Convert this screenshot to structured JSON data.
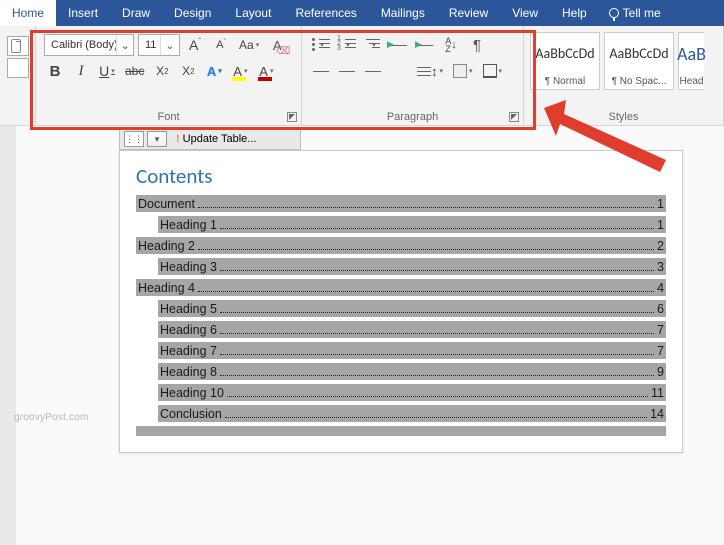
{
  "tabs": {
    "items": [
      "Home",
      "Insert",
      "Draw",
      "Design",
      "Layout",
      "References",
      "Mailings",
      "Review",
      "View",
      "Help"
    ],
    "active": "Home",
    "tell_me": "Tell me"
  },
  "font": {
    "name": "Calibri (Body)",
    "size": "11",
    "label": "Font",
    "bold": "B",
    "italic": "I",
    "underline": "U",
    "strike": "abc",
    "sub_base": "X",
    "sub_small": "2",
    "sup_base": "X",
    "sup_small": "2",
    "txfx": "A",
    "highlight": "A",
    "color": "A",
    "grow": "A",
    "grow_sup": "ˆ",
    "shrink": "A",
    "shrink_sup": "ˇ",
    "case": "Aa",
    "clear": "A",
    "clear_er": "⌫"
  },
  "para": {
    "label": "Paragraph",
    "sort": "A",
    "sort_z": "Z",
    "pilcrow": "¶"
  },
  "styles": {
    "label": "Styles",
    "preview": "AaBbCcDd",
    "preview_head": "AaB",
    "normal": "¶ Normal",
    "nospace": "¶ No Spac...",
    "head": "Head"
  },
  "toc": {
    "controls": {
      "update": "Update Table..."
    },
    "title": "Contents",
    "entries": [
      {
        "text": "Document",
        "page": "1",
        "level": 1
      },
      {
        "text": "Heading 1",
        "page": "1",
        "level": 2
      },
      {
        "text": "Heading 2",
        "page": "2",
        "level": 1
      },
      {
        "text": "Heading 3",
        "page": "3",
        "level": 2
      },
      {
        "text": "Heading 4",
        "page": "4",
        "level": 1
      },
      {
        "text": "Heading 5",
        "page": "6",
        "level": 2
      },
      {
        "text": "Heading 6",
        "page": "7",
        "level": 2
      },
      {
        "text": "Heading 7",
        "page": "7",
        "level": 2
      },
      {
        "text": "Heading 8",
        "page": "9",
        "level": 2
      },
      {
        "text": "Heading 10",
        "page": "11",
        "level": 2
      },
      {
        "text": "Conclusion",
        "page": "14",
        "level": 2
      }
    ]
  },
  "watermark": "groovyPost.com"
}
